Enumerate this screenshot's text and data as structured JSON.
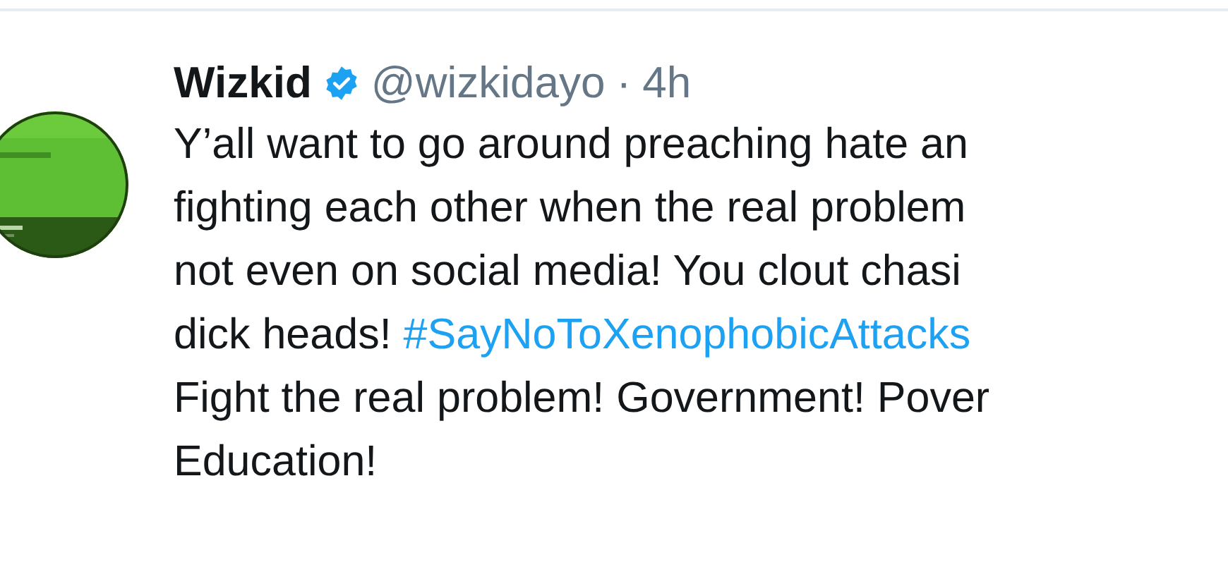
{
  "tweet": {
    "author": {
      "name": "Wizkid",
      "verified": true,
      "handle": "@wizkidayo",
      "separator": "·",
      "time": "4h"
    },
    "avatar": {
      "kind": "picture"
    },
    "lines": [
      [
        {
          "kind": "text",
          "text": "Y’all want to go around preaching hate an"
        }
      ],
      [
        {
          "kind": "text",
          "text": "fighting each other when the real problem"
        }
      ],
      [
        {
          "kind": "text",
          "text": "not even on social media! You clout chasi"
        }
      ],
      [
        {
          "kind": "text",
          "text": "dick heads! "
        },
        {
          "kind": "hashtag",
          "text": "#SayNoToXenophobicAttacks"
        }
      ],
      [
        {
          "kind": "text",
          "text": "Fight the real problem! Government! Pover"
        }
      ],
      [
        {
          "kind": "text",
          "text": "Education!"
        }
      ]
    ]
  }
}
